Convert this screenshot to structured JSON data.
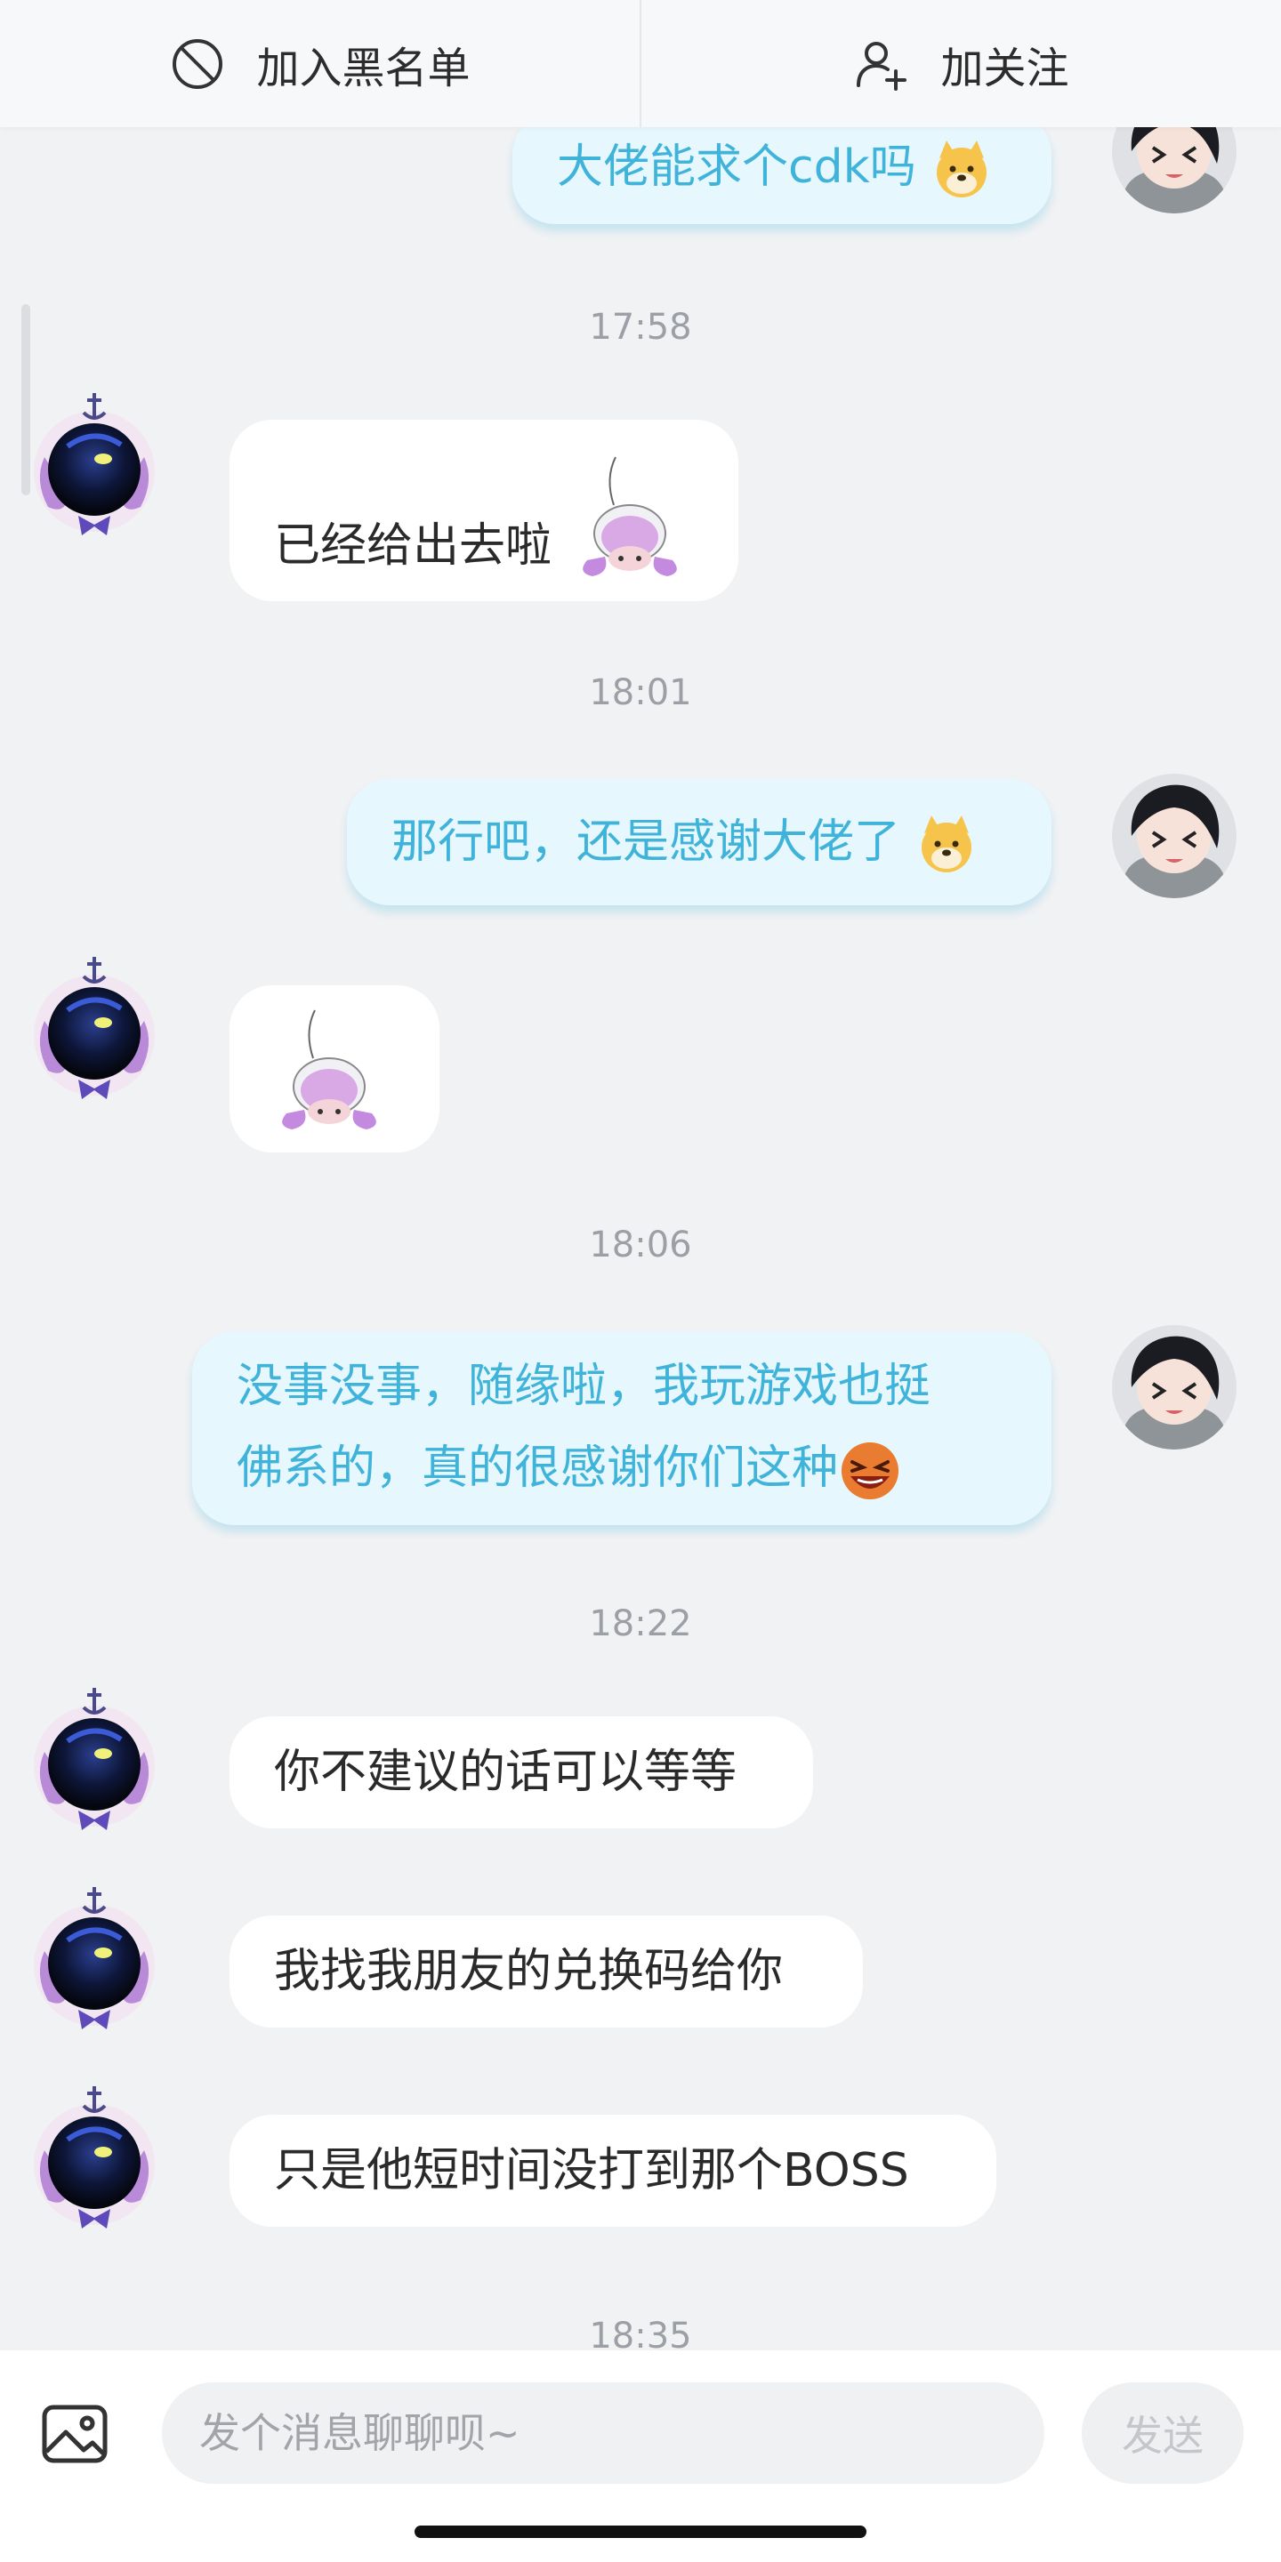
{
  "topbar": {
    "block_label": "加入黑名单",
    "follow_label": "加关注"
  },
  "messages": [
    {
      "side": "me",
      "text": "大佬能求个cdk吗",
      "emoji": "doge-emoji"
    },
    {
      "side": "time",
      "text": "17:58"
    },
    {
      "side": "other",
      "text": "已经给出去啦",
      "sticker": "bowing-character-sticker"
    },
    {
      "side": "time",
      "text": "18:01"
    },
    {
      "side": "me",
      "text": "那行吧，还是感谢大佬了",
      "emoji": "doge-emoji"
    },
    {
      "side": "other",
      "text": "",
      "sticker": "bowing-character-sticker"
    },
    {
      "side": "time",
      "text": "18:06"
    },
    {
      "side": "me",
      "lines": [
        "没事没事，随缘啦，我玩游戏也挺",
        "佛系的，真的很感谢你们这种"
      ],
      "emoji": "laughing-emoji"
    },
    {
      "side": "time",
      "text": "18:22"
    },
    {
      "side": "other",
      "text": "你不建议的话可以等等"
    },
    {
      "side": "other",
      "text": "我找我朋友的兑换码给你"
    },
    {
      "side": "other",
      "text": "只是他短时间没打到那个BOSS"
    },
    {
      "side": "time",
      "text": "18:35"
    }
  ],
  "input": {
    "placeholder": "发个消息聊聊呗~",
    "value": "",
    "send_label": "发送"
  },
  "colors": {
    "background": "#f1f2f4",
    "my_bubble": "#e6f7fd",
    "my_text": "#3fb3d9",
    "other_bubble": "#ffffff"
  }
}
